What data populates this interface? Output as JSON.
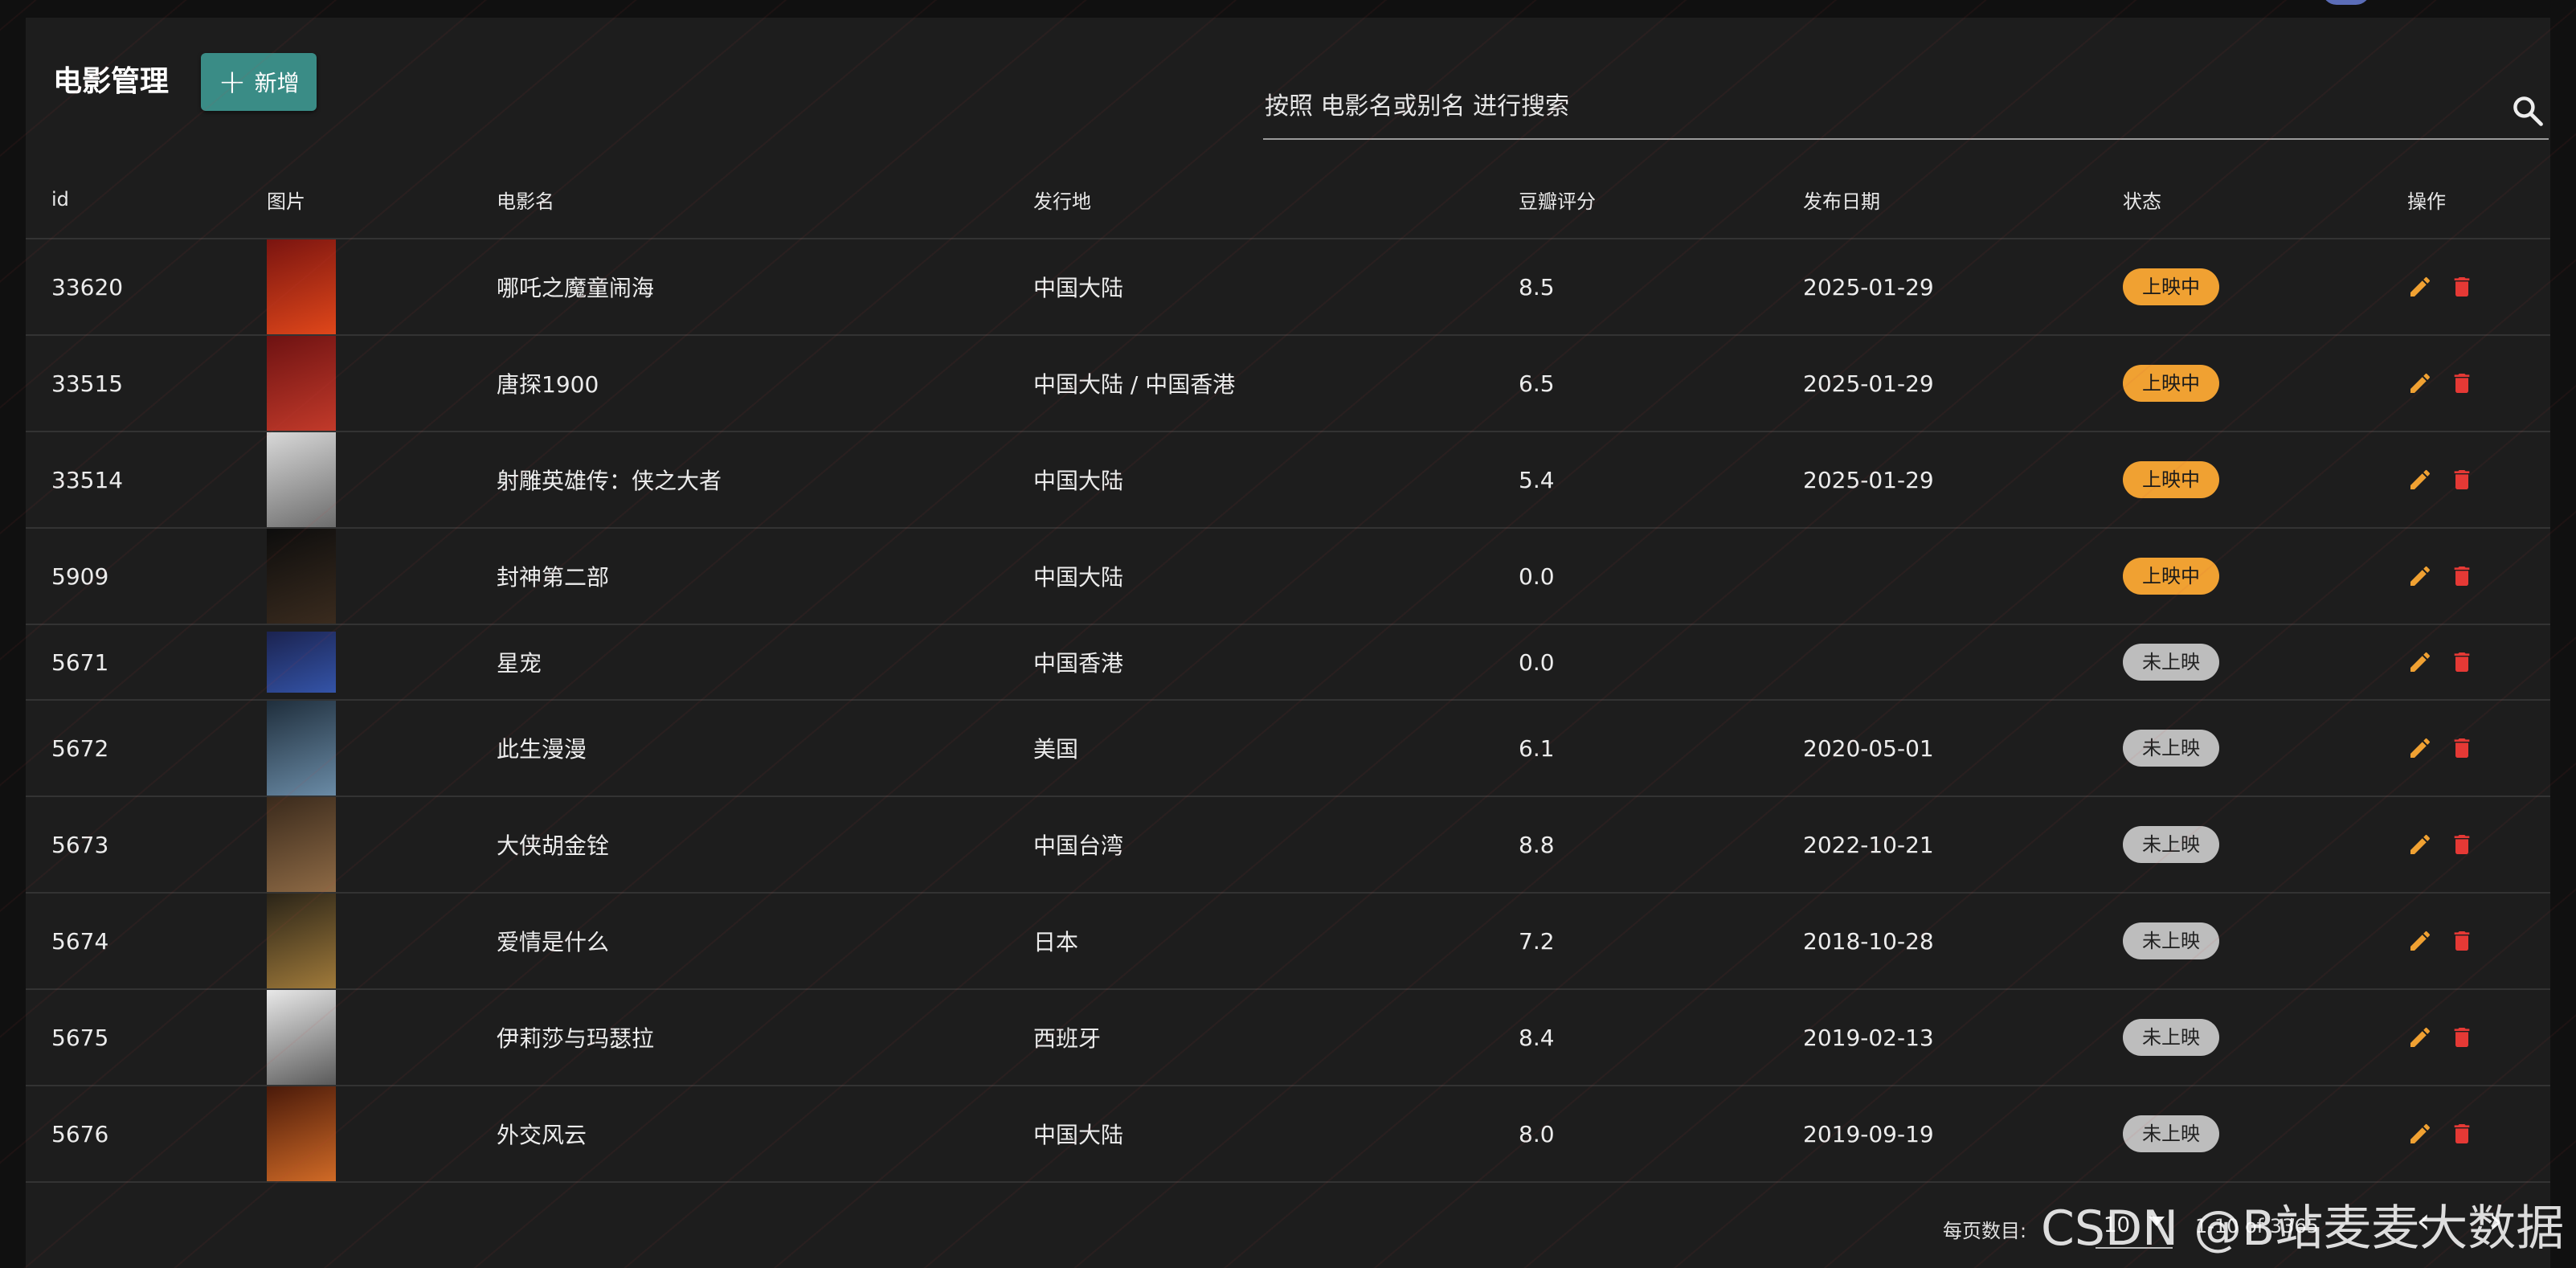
{
  "header": {
    "title": "电影管理",
    "add_label": "新增",
    "search_placeholder": "按照 电影名或别名 进行搜索"
  },
  "table": {
    "columns": [
      "id",
      "图片",
      "电影名",
      "发行地",
      "豆瓣评分",
      "发布日期",
      "状态",
      "操作"
    ],
    "rows": [
      {
        "id": "33620",
        "title": "哪吒之魔童闹海",
        "region": "中国大陆",
        "score": "8.5",
        "date": "2025-01-29",
        "status": "上映中",
        "status_kind": "on",
        "poster": [
          "#7a1410",
          "#e0471a"
        ]
      },
      {
        "id": "33515",
        "title": "唐探1900",
        "region": "中国大陆 / 中国香港",
        "score": "6.5",
        "date": "2025-01-29",
        "status": "上映中",
        "status_kind": "on",
        "poster": [
          "#6e1212",
          "#c23a2a"
        ]
      },
      {
        "id": "33514",
        "title": "射雕英雄传：侠之大者",
        "region": "中国大陆",
        "score": "5.4",
        "date": "2025-01-29",
        "status": "上映中",
        "status_kind": "on",
        "poster": [
          "#d8d8d8",
          "#6d6d6d"
        ]
      },
      {
        "id": "5909",
        "title": "封神第二部",
        "region": "中国大陆",
        "score": "0.0",
        "date": "",
        "status": "上映中",
        "status_kind": "on",
        "poster": [
          "#0d0d0d",
          "#3a2b1e"
        ]
      },
      {
        "id": "5671",
        "title": "星宠",
        "region": "中国香港",
        "score": "0.0",
        "date": "",
        "status": "未上映",
        "status_kind": "off",
        "poster": [
          "#1b2350",
          "#3454a8"
        ]
      },
      {
        "id": "5672",
        "title": "此生漫漫",
        "region": "美国",
        "score": "6.1",
        "date": "2020-05-01",
        "status": "未上映",
        "status_kind": "off",
        "poster": [
          "#1f2e3c",
          "#6a8ba6"
        ]
      },
      {
        "id": "5673",
        "title": "大侠胡金铨",
        "region": "中国台湾",
        "score": "8.8",
        "date": "2022-10-21",
        "status": "未上映",
        "status_kind": "off",
        "poster": [
          "#3a2a1c",
          "#8e6a45"
        ]
      },
      {
        "id": "5674",
        "title": "爱情是什么",
        "region": "日本",
        "score": "7.2",
        "date": "2018-10-28",
        "status": "未上映",
        "status_kind": "off",
        "poster": [
          "#2a2418",
          "#a07a3a"
        ]
      },
      {
        "id": "5675",
        "title": "伊莉莎与玛瑟拉",
        "region": "西班牙",
        "score": "8.4",
        "date": "2019-02-13",
        "status": "未上映",
        "status_kind": "off",
        "poster": [
          "#e8e8e8",
          "#5a5a5a"
        ]
      },
      {
        "id": "5676",
        "title": "外交风云",
        "region": "中国大陆",
        "score": "8.0",
        "date": "2019-09-19",
        "status": "未上映",
        "status_kind": "off",
        "poster": [
          "#4a1a0a",
          "#d06a26"
        ]
      }
    ]
  },
  "pager": {
    "per_page_label": "每页数目:",
    "per_page_value": "10",
    "range_text": "1-10 of 3365"
  },
  "watermark_text": "CSDN @B站麦麦大数据",
  "colors": {
    "accent": "#3a8c86",
    "status_on": "#f0a132",
    "status_off": "#bdbdbd",
    "edit_icon": "#f0a132",
    "delete_icon": "#e53935"
  }
}
